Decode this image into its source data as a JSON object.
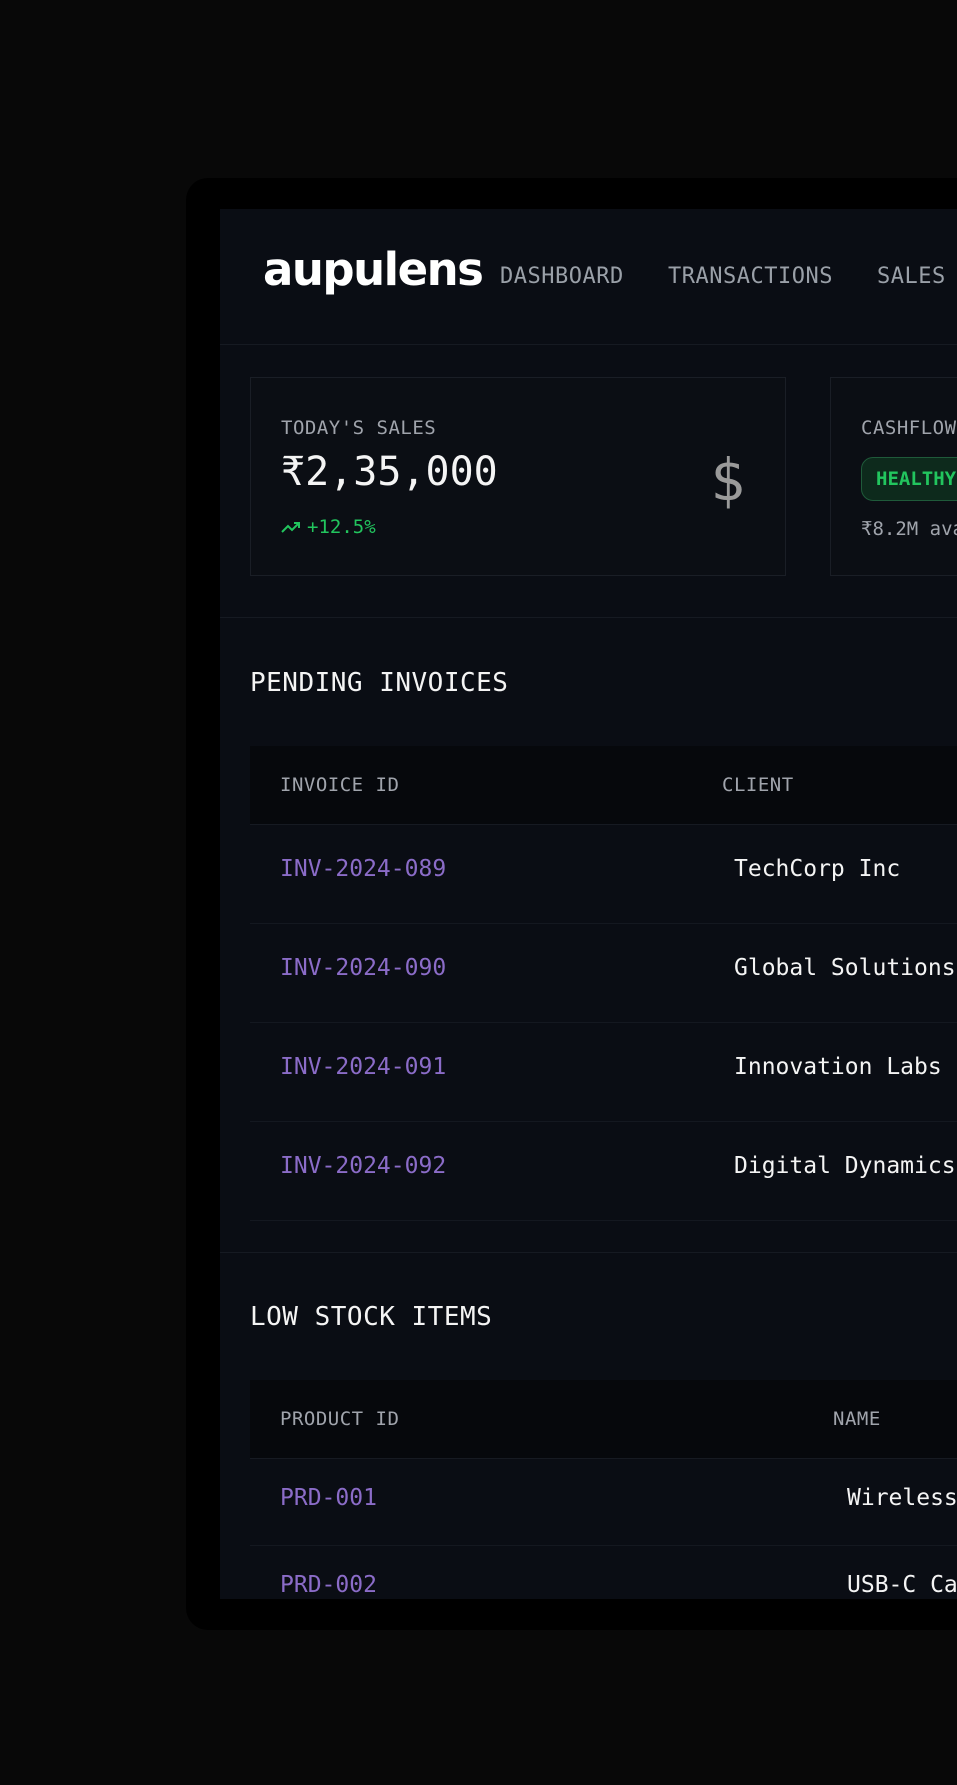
{
  "header": {
    "logo": "aupulens",
    "nav": [
      "DASHBOARD",
      "TRANSACTIONS",
      "SALES"
    ]
  },
  "stats": {
    "sales": {
      "label": "TODAY'S SALES",
      "value": "₹2,35,000",
      "trend": "+12.5%",
      "icon": "dollar-icon"
    },
    "cashflow": {
      "label": "CASHFLOW",
      "badge": "HEALTHY",
      "sub": "₹8.2M ava"
    }
  },
  "invoices": {
    "title": "PENDING INVOICES",
    "columns": [
      "INVOICE ID",
      "CLIENT"
    ],
    "rows": [
      {
        "id": "INV-2024-089",
        "client": "TechCorp Inc"
      },
      {
        "id": "INV-2024-090",
        "client": "Global Solutions"
      },
      {
        "id": "INV-2024-091",
        "client": "Innovation Labs"
      },
      {
        "id": "INV-2024-092",
        "client": "Digital Dynamics"
      }
    ]
  },
  "stock": {
    "title": "LOW STOCK ITEMS",
    "columns": [
      "PRODUCT ID",
      "NAME"
    ],
    "rows": [
      {
        "id": "PRD-001",
        "name": "Wireless"
      },
      {
        "id": "PRD-002",
        "name": "USB-C Ca"
      }
    ]
  },
  "colors": {
    "background": "#0a0d14",
    "accent_link": "#8b6cc8",
    "positive": "#22c55e"
  }
}
